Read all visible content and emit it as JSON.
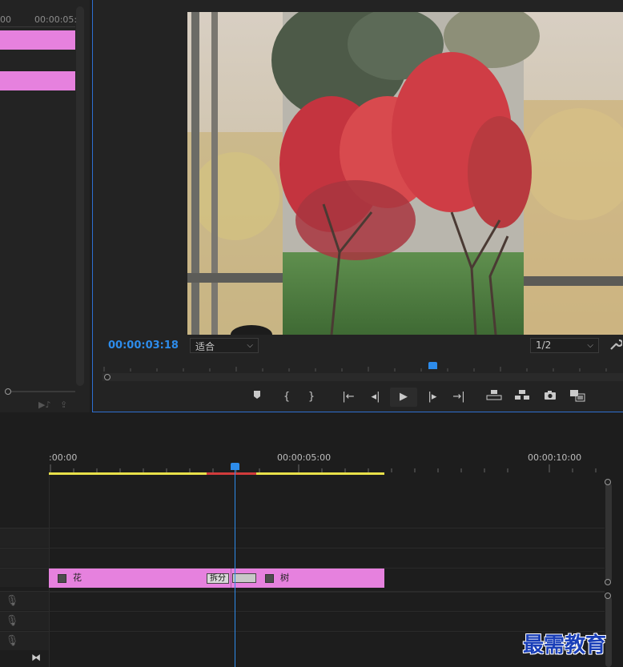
{
  "source_panel": {
    "ruler_start": "00",
    "ruler_tc": "00:00:05:"
  },
  "program_monitor": {
    "timecode": "00:00:03:18",
    "zoom_select": "适合",
    "resolution_select": "1/2",
    "settings_icon": "wrench-icon",
    "controls": [
      "add-marker-icon",
      "mark-in-icon",
      "mark-out-icon",
      "go-to-in-icon",
      "step-back-icon",
      "play-icon",
      "step-forward-icon",
      "go-to-out-icon",
      "lift-icon",
      "extract-icon",
      "export-frame-icon",
      "compare-view-icon"
    ],
    "glyphs": {
      "add_marker": "⬥",
      "mark_in": "{",
      "mark_out": "}",
      "go_to_in": "|←",
      "step_back": "◂|",
      "play": "▶",
      "step_forward": "|▸",
      "go_to_out": "→|"
    }
  },
  "timeline": {
    "ruler_labels": [
      ":00:00",
      "00:00:05:00",
      "00:00:10:00"
    ],
    "clip_a": "花",
    "clip_b": "树",
    "tooltip": "拆分",
    "accent_colors": {
      "clip": "#e681de",
      "playhead": "#2d8ceb",
      "work_area": "#e8e04a",
      "render_red": "#d23c3c"
    }
  },
  "watermark": "最需教育"
}
